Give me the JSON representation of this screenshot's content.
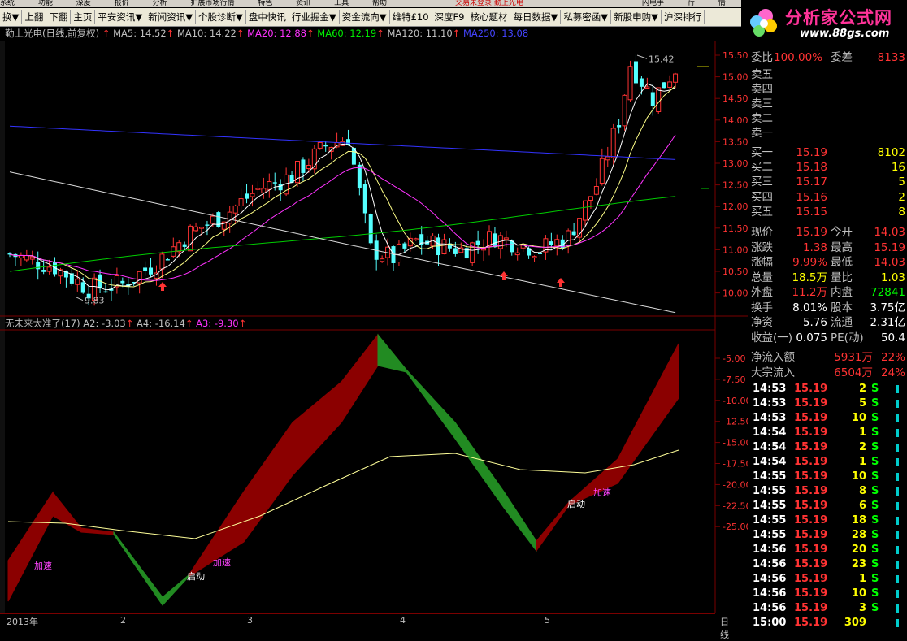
{
  "menu": {
    "items": [
      "系统",
      "功能",
      "深度",
      "报价",
      "分析",
      "扩展市场行情",
      "特色",
      "资讯",
      "工具",
      "帮助"
    ],
    "center": "交易未登录  勤上光电",
    "right": [
      "闪电手",
      "行",
      "情"
    ]
  },
  "toolbar": [
    "换▼",
    "上翻",
    "下翻",
    "主页",
    "平安资讯▼",
    "新闻资讯▼",
    "个股诊断▼",
    "盘中快讯",
    "行业掘金▼",
    "资金流向▼",
    "维特£10",
    "深度F9",
    "核心题材",
    "每日数据▼",
    "私募密函▼",
    "新股申购▼",
    "沪深排行"
  ],
  "logo": {
    "title": "分析家公式网",
    "url": "www.88gs.com"
  },
  "chart_info": {
    "stock": "勤上光电(日线,前复权)",
    "ma5": "MA5: 14.52",
    "ma10": "MA10: 14.22",
    "ma20": "MA20: 12.88",
    "ma60": "MA60: 12.19",
    "ma120": "MA120: 11.10",
    "ma250": "MA250: 13.08"
  },
  "indicator_info": {
    "name": "无未来太准了(17)",
    "a2": "A2: -3.03",
    "a4": "A4: -16.14",
    "a3": "A3: -9.30"
  },
  "annotations": {
    "high": "15.42",
    "low": "9.83",
    "accel": "加速",
    "start": "启动"
  },
  "price_axis": [
    "15.50",
    "15.00",
    "14.50",
    "14.00",
    "13.50",
    "13.00",
    "12.50",
    "12.00",
    "11.50",
    "11.00",
    "10.50",
    "10.00"
  ],
  "ind_axis": [
    "-5.00",
    "-7.50",
    "-10.00",
    "-12.50",
    "-15.00",
    "-17.50",
    "-20.00",
    "-22.50",
    "-25.00"
  ],
  "xaxis": {
    "labels": [
      "2013年",
      "2",
      "3",
      "4",
      "5"
    ],
    "period": "日线"
  },
  "quote": {
    "weibi_label": "委比",
    "weibi": "100.00%",
    "weicha_label": "委差",
    "weicha": "8133",
    "sell_labels": [
      "卖五",
      "卖四",
      "卖三",
      "卖二",
      "卖一"
    ],
    "buy": [
      {
        "label": "买一",
        "price": "15.19",
        "vol": "8102"
      },
      {
        "label": "买二",
        "price": "15.18",
        "vol": "16"
      },
      {
        "label": "买三",
        "price": "15.17",
        "vol": "5"
      },
      {
        "label": "买四",
        "price": "15.16",
        "vol": "2"
      },
      {
        "label": "买五",
        "price": "15.15",
        "vol": "8"
      }
    ],
    "stats": [
      [
        "现价",
        "15.19",
        "今开",
        "14.03"
      ],
      [
        "涨跌",
        "1.38",
        "最高",
        "15.19"
      ],
      [
        "涨幅",
        "9.99%",
        "最低",
        "14.03"
      ],
      [
        "总量",
        "18.5万",
        "量比",
        "1.03"
      ],
      [
        "外盘",
        "11.2万",
        "内盘",
        "72841"
      ],
      [
        "换手",
        "8.01%",
        "股本",
        "3.75亿"
      ],
      [
        "净资",
        "5.76",
        "流通",
        "2.31亿"
      ],
      [
        "收益(一)",
        "0.075",
        "PE(动)",
        "50.4"
      ]
    ],
    "netflow": {
      "label": "净流入额",
      "value": "5931万",
      "pct": "22%"
    },
    "bigflow": {
      "label": "大宗流入",
      "value": "6504万",
      "pct": "24%"
    }
  },
  "ticks": [
    [
      "14:53",
      "15.19",
      "2",
      "S"
    ],
    [
      "14:53",
      "15.19",
      "5",
      "S"
    ],
    [
      "14:53",
      "15.19",
      "10",
      "S"
    ],
    [
      "14:54",
      "15.19",
      "1",
      "S"
    ],
    [
      "14:54",
      "15.19",
      "2",
      "S"
    ],
    [
      "14:54",
      "15.19",
      "1",
      "S"
    ],
    [
      "14:55",
      "15.19",
      "10",
      "S"
    ],
    [
      "14:55",
      "15.19",
      "8",
      "S"
    ],
    [
      "14:55",
      "15.19",
      "6",
      "S"
    ],
    [
      "14:55",
      "15.19",
      "18",
      "S"
    ],
    [
      "14:55",
      "15.19",
      "28",
      "S"
    ],
    [
      "14:56",
      "15.19",
      "20",
      "S"
    ],
    [
      "14:56",
      "15.19",
      "23",
      "S"
    ],
    [
      "14:56",
      "15.19",
      "1",
      "S"
    ],
    [
      "14:56",
      "15.19",
      "10",
      "S"
    ],
    [
      "14:56",
      "15.19",
      "3",
      "S"
    ],
    [
      "15:00",
      "15.19",
      "309",
      ""
    ]
  ],
  "colors": {
    "red": "#ff3333",
    "cyan": "#54ffff",
    "white": "#ffffff",
    "yellow": "#ffff00",
    "magenta": "#ff00ff",
    "green": "#00cc00",
    "blue": "#3333ff",
    "darkred": "#8b0000",
    "bandgreen": "#228b22"
  }
}
